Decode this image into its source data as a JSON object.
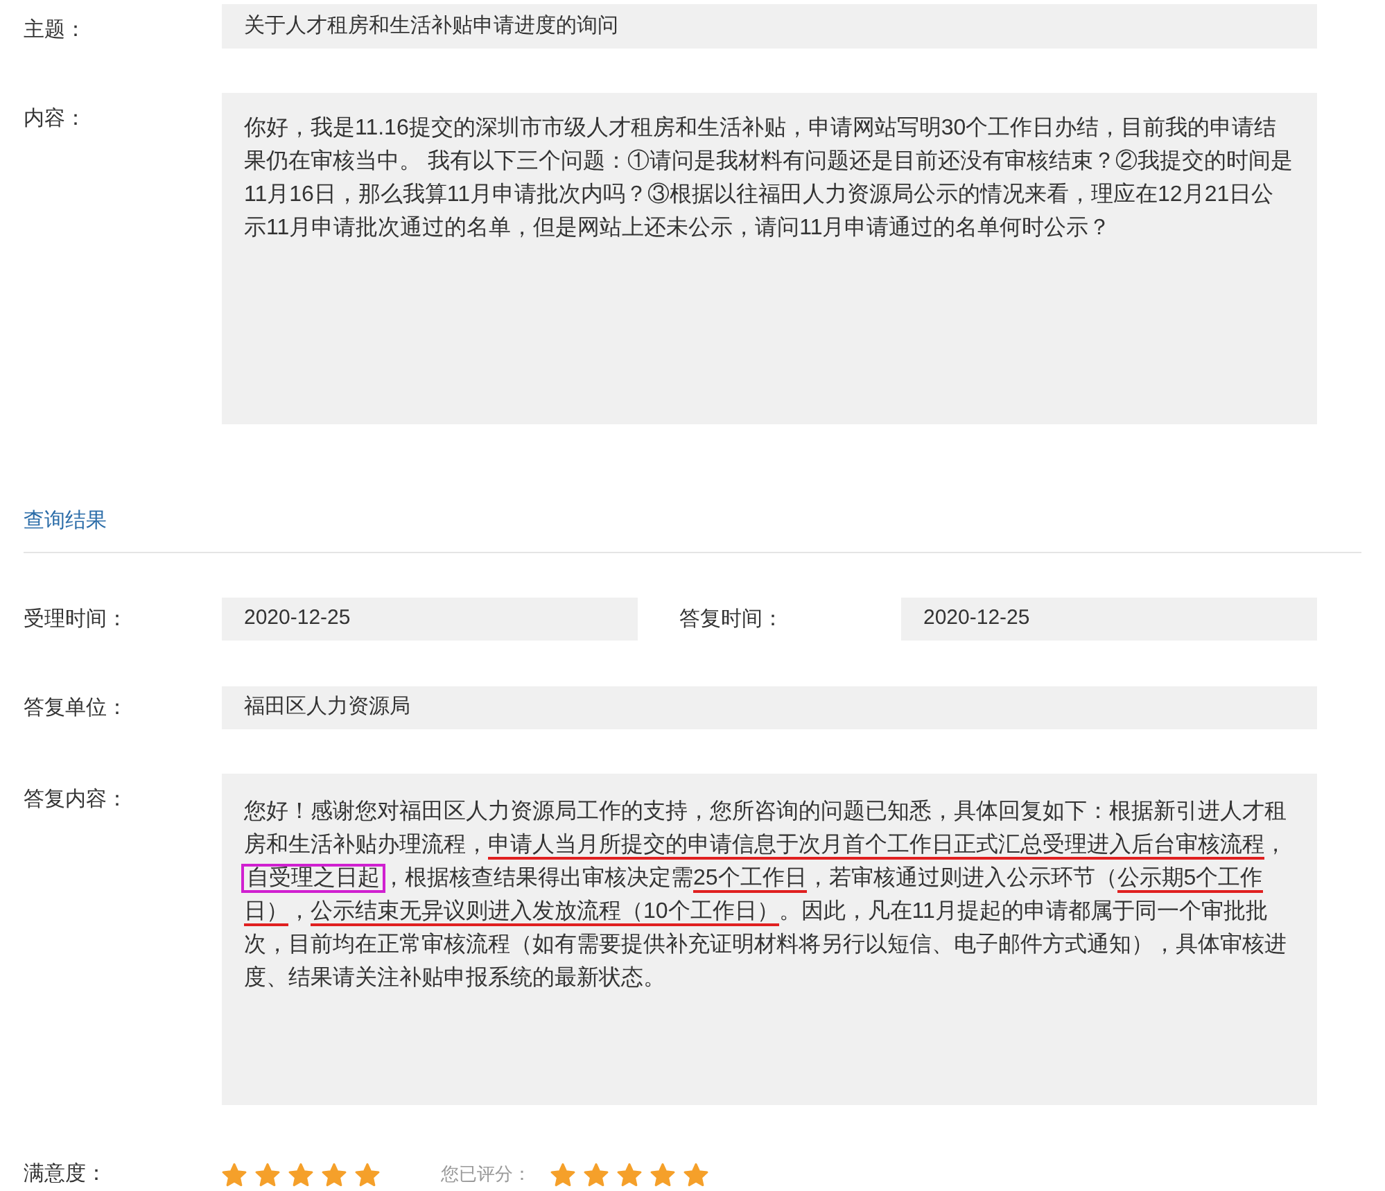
{
  "subject": {
    "label": "主题：",
    "value": "关于人才租房和生活补贴申请进度的询问"
  },
  "content": {
    "label": "内容：",
    "value": "你好，我是11.16提交的深圳市市级人才租房和生活补贴，申请网站写明30个工作日办结，目前我的申请结果仍在审核当中。 我有以下三个问题：①请问是我材料有问题还是目前还没有审核结束？②我提交的时间是11月16日，那么我算11月申请批次内吗？③根据以往福田人力资源局公示的情况来看，理应在12月21日公示11月申请批次通过的名单，但是网站上还未公示，请问11月申请通过的名单何时公示？"
  },
  "section_title": "查询结果",
  "accept_time": {
    "label": "受理时间：",
    "value": "2020-12-25"
  },
  "reply_time": {
    "label": "答复时间：",
    "value": "2020-12-25"
  },
  "reply_unit": {
    "label": "答复单位：",
    "value": "福田区人力资源局"
  },
  "reply": {
    "label": "答复内容：",
    "segments": [
      {
        "kind": "plain",
        "text": "您好！感谢您对福田区人力资源局工作的支持，您所咨询的问题已知悉，具体回复如下：根据新引进人才租房和生活补贴办理流程，"
      },
      {
        "kind": "underline",
        "text": "申请人当月所提交的申请信息于次月首个工作日正式汇总受理进入后台审核流程"
      },
      {
        "kind": "plain",
        "text": "，"
      },
      {
        "kind": "box",
        "text": "自受理之日起"
      },
      {
        "kind": "plain",
        "text": "，根据核查结果得出审核决定需"
      },
      {
        "kind": "underline",
        "text": "25个工作日"
      },
      {
        "kind": "plain",
        "text": "，若审核通过则进入公示环节（"
      },
      {
        "kind": "underline",
        "text": "公示期5个工作日）"
      },
      {
        "kind": "plain",
        "text": "，"
      },
      {
        "kind": "underline",
        "text": "公示结束无异议则进入发放流程（10个工作日）"
      },
      {
        "kind": "plain",
        "text": "。因此，凡在11月提起的申请都属于同一个审批批次，目前均在正常审核流程（如有需要提供补充证明材料将另行以短信、电子邮件方式通知），具体审核进度、结果请关注补贴申报系统的最新状态。"
      }
    ]
  },
  "satisfaction": {
    "label": "满意度：",
    "stars": 5
  },
  "rated": {
    "label": "您已评分：",
    "stars": 5
  }
}
